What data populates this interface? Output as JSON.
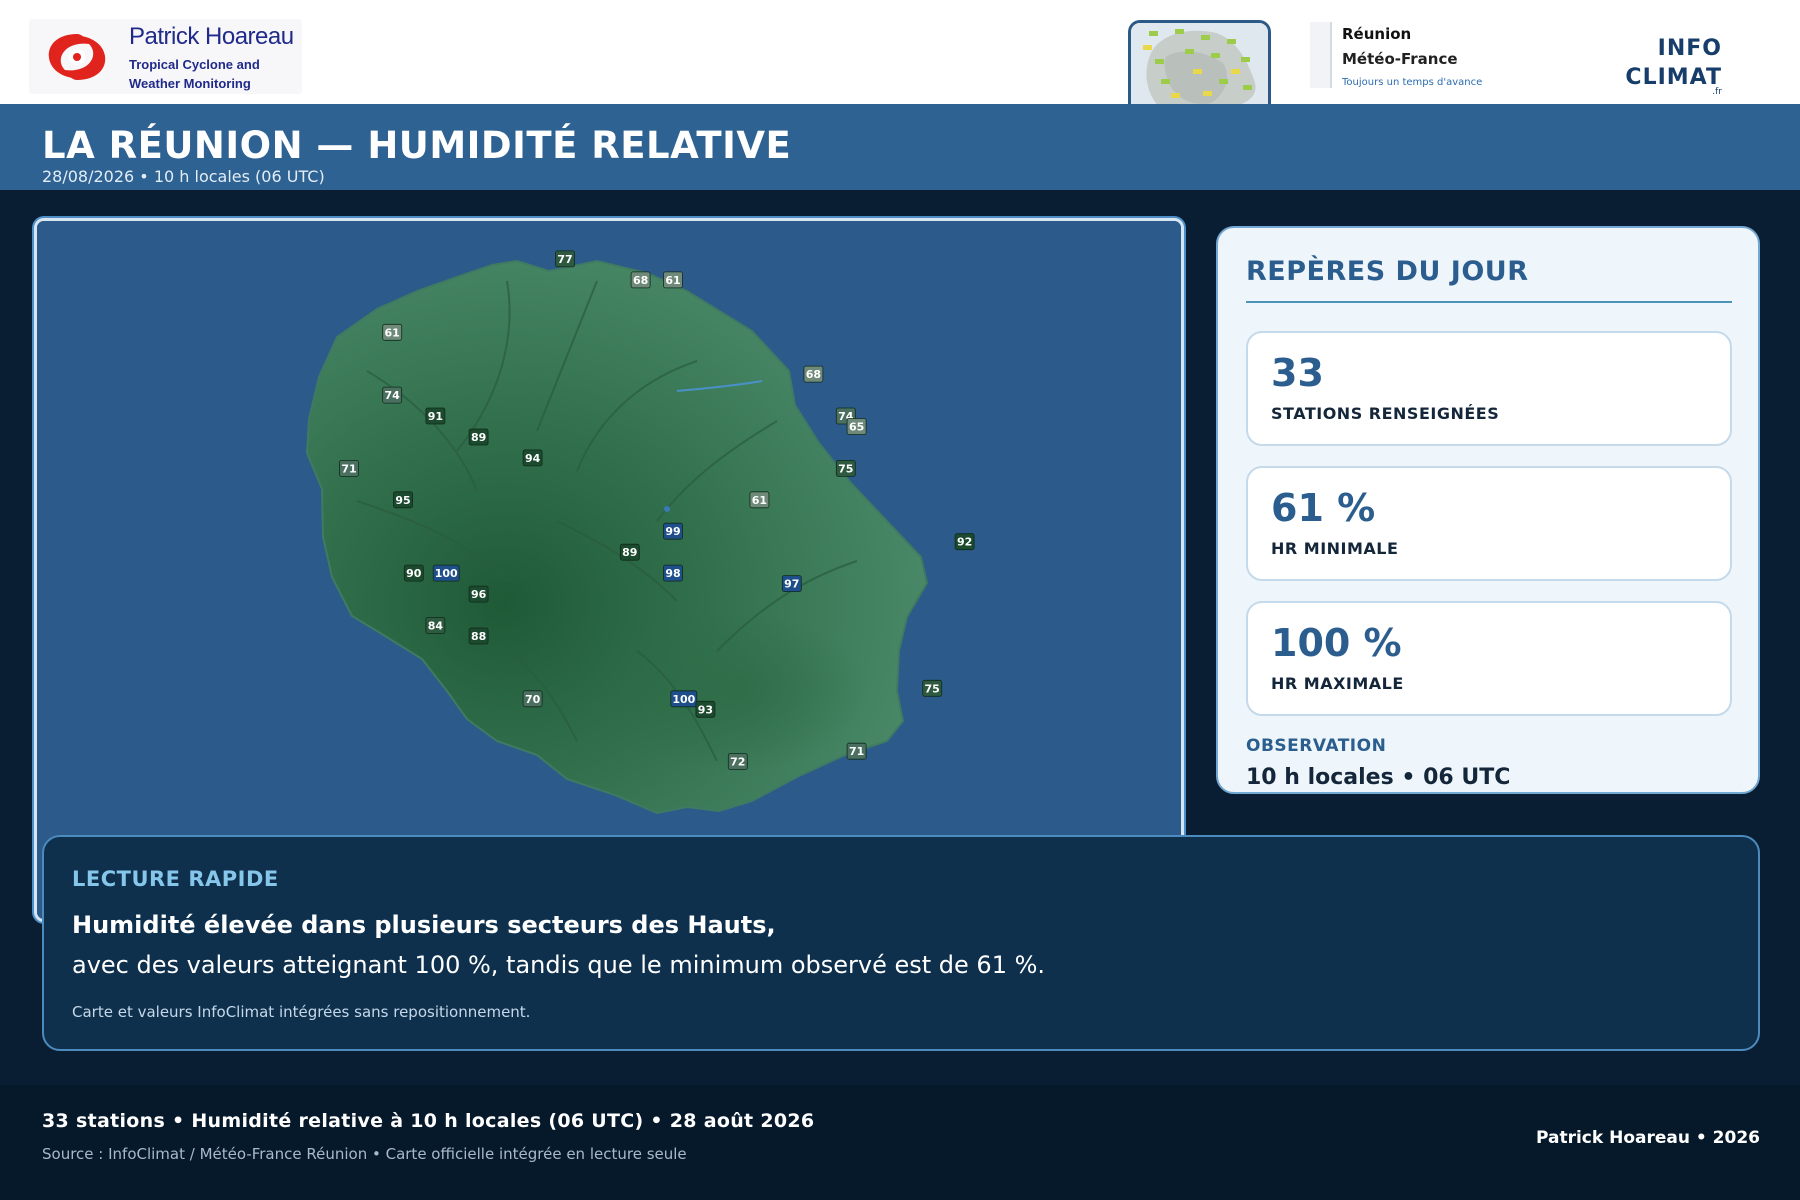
{
  "header": {
    "brand_name": "Patrick Hoareau",
    "brand_tagline_1": "Tropical Cyclone and",
    "brand_tagline_2": "Weather Monitoring",
    "meteofrance_line1": "Réunion",
    "meteofrance_line2": "Météo-France",
    "meteofrance_slogan": "Toujours un temps d'avance",
    "infoclimat_line1": "INFO",
    "infoclimat_line2": "CLIMAT",
    "infoclimat_suffix": ".fr"
  },
  "title": {
    "main": "LA RÉUNION — HUMIDITÉ RELATIVE",
    "subtitle": "28/08/2026 • 10 h locales (06 UTC)"
  },
  "map": {
    "stations": [
      {
        "label": "77",
        "lon": 55.45,
        "lat": -20.87
      },
      {
        "label": "68",
        "lon": 55.52,
        "lat": -20.89
      },
      {
        "label": "61",
        "lon": 55.55,
        "lat": -20.89
      },
      {
        "label": "61",
        "lon": 55.29,
        "lat": -20.94
      },
      {
        "label": "68",
        "lon": 55.68,
        "lat": -20.98
      },
      {
        "label": "74",
        "lon": 55.29,
        "lat": -21.0
      },
      {
        "label": "91",
        "lon": 55.33,
        "lat": -21.02
      },
      {
        "label": "74",
        "lon": 55.71,
        "lat": -21.02
      },
      {
        "label": "65",
        "lon": 55.72,
        "lat": -21.03
      },
      {
        "label": "89",
        "lon": 55.37,
        "lat": -21.04
      },
      {
        "label": "94",
        "lon": 55.42,
        "lat": -21.06
      },
      {
        "label": "71",
        "lon": 55.25,
        "lat": -21.07
      },
      {
        "label": "75",
        "lon": 55.71,
        "lat": -21.07
      },
      {
        "label": "95",
        "lon": 55.3,
        "lat": -21.1
      },
      {
        "label": "61",
        "lon": 55.63,
        "lat": -21.1
      },
      {
        "label": "99",
        "lon": 55.55,
        "lat": -21.13
      },
      {
        "label": "92",
        "lon": 55.82,
        "lat": -21.14
      },
      {
        "label": "89",
        "lon": 55.51,
        "lat": -21.15
      },
      {
        "label": "90",
        "lon": 55.31,
        "lat": -21.17
      },
      {
        "label": "100",
        "lon": 55.34,
        "lat": -21.17
      },
      {
        "label": "98",
        "lon": 55.55,
        "lat": -21.17
      },
      {
        "label": "97",
        "lon": 55.66,
        "lat": -21.18
      },
      {
        "label": "96",
        "lon": 55.37,
        "lat": -21.19
      },
      {
        "label": "84",
        "lon": 55.33,
        "lat": -21.22
      },
      {
        "label": "88",
        "lon": 55.37,
        "lat": -21.23
      },
      {
        "label": "70",
        "lon": 55.42,
        "lat": -21.29
      },
      {
        "label": "75",
        "lon": 55.79,
        "lat": -21.28
      },
      {
        "label": "100",
        "lon": 55.56,
        "lat": -21.29
      },
      {
        "label": "93",
        "lon": 55.58,
        "lat": -21.3
      },
      {
        "label": "71",
        "lon": 55.72,
        "lat": -21.34
      },
      {
        "label": "72",
        "lon": 55.61,
        "lat": -21.35
      }
    ]
  },
  "highlights": {
    "heading": "REPÈRES DU JOUR",
    "stations_value": "33",
    "stations_label": "STATIONS RENSEIGNÉES",
    "min_value": "61 %",
    "min_label": "HR MINIMALE",
    "max_value": "100 %",
    "max_label": "HR MAXIMALE",
    "observation_label": "OBSERVATION",
    "observation_value": "10 h locales • 06 UTC"
  },
  "quick_read": {
    "heading": "LECTURE RAPIDE",
    "headline": "Humidité élevée dans plusieurs secteurs des Hauts,",
    "body": "avec des valeurs atteignant 100 %, tandis que le minimum observé est de 61 %.",
    "note": "Carte et valeurs InfoClimat intégrées sans repositionnement."
  },
  "footer": {
    "summary": "33 stations • Humidité relative à 10 h locales (06 UTC) • 28 août 2026",
    "source": "Source : InfoClimat / Météo-France Réunion • Carte officielle intégrée en lecture seule",
    "credit": "Patrick Hoareau • 2026"
  },
  "colors": {
    "title_band": "#2e6292",
    "accent": "#2b5e8e",
    "sea": "#2c5a8a",
    "island": "#3d7f5e"
  }
}
